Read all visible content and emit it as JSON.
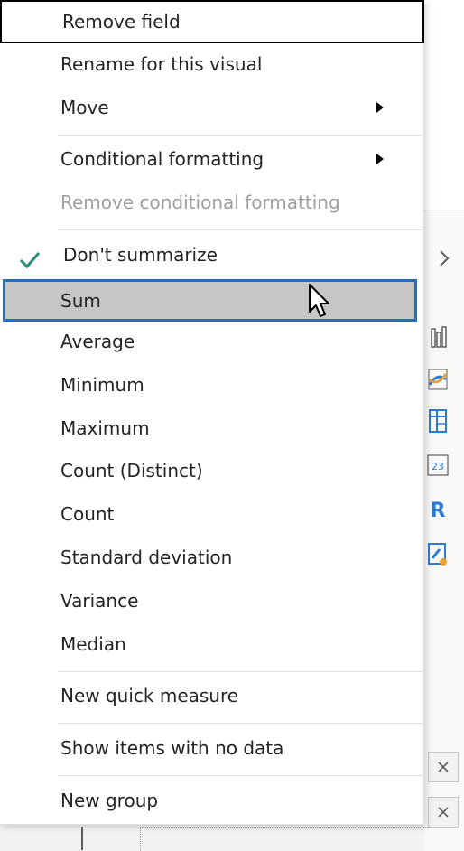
{
  "context_menu": {
    "items": [
      {
        "label": "Remove field"
      },
      {
        "label": "Rename for this visual"
      },
      {
        "label": "Move"
      },
      {
        "label": "Conditional formatting"
      },
      {
        "label": "Remove conditional formatting"
      },
      {
        "label": "Don't summarize"
      },
      {
        "label": "Sum"
      },
      {
        "label": "Average"
      },
      {
        "label": "Minimum"
      },
      {
        "label": "Maximum"
      },
      {
        "label": "Count (Distinct)"
      },
      {
        "label": "Count"
      },
      {
        "label": "Standard deviation"
      },
      {
        "label": "Variance"
      },
      {
        "label": "Median"
      },
      {
        "label": "New quick measure"
      },
      {
        "label": "Show items with no data"
      },
      {
        "label": "New group"
      }
    ],
    "checked_item": "Don't summarize",
    "hovered_item": "Sum",
    "disabled_item": "Remove conditional formatting"
  },
  "background": {
    "r_visual_letter": "R",
    "table_visual_number": "23"
  },
  "colors": {
    "check": "#2e8b76",
    "highlight_outline": "#1f6fc4",
    "hover_fill": "#c8c6c4",
    "disabled_text": "#a19f9d"
  },
  "icons": [
    "check-icon",
    "chevron-right-icon",
    "close-icon",
    "mouse-cursor-icon"
  ]
}
